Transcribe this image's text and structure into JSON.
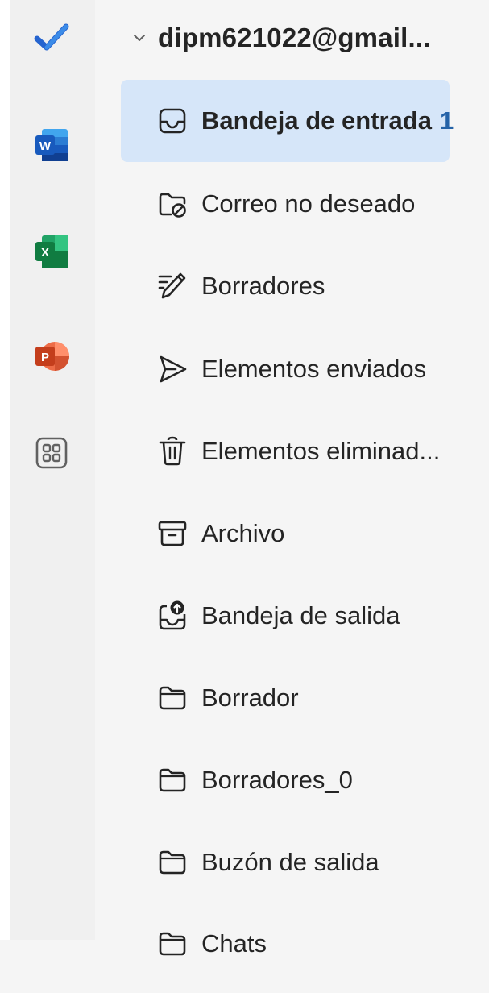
{
  "rail": {
    "apps": [
      {
        "name": "To Do",
        "icon": "todo-check-icon",
        "color": "#2564cf"
      },
      {
        "name": "Word",
        "icon": "word-icon",
        "color": "#185abd"
      },
      {
        "name": "Excel",
        "icon": "excel-icon",
        "color": "#107c41"
      },
      {
        "name": "PowerPoint",
        "icon": "powerpoint-icon",
        "color": "#c43e1c"
      },
      {
        "name": "More apps",
        "icon": "apps-grid-icon",
        "color": "#616161"
      }
    ]
  },
  "account": {
    "email": "dipm621022@gmail...",
    "expanded": true
  },
  "folders": [
    {
      "label": "Bandeja de entrada",
      "count": "1",
      "icon": "inbox-icon",
      "selected": true
    },
    {
      "label": "Correo no deseado",
      "icon": "junk-folder-icon"
    },
    {
      "label": "Borradores",
      "icon": "drafts-pencil-icon"
    },
    {
      "label": "Elementos enviados",
      "icon": "send-icon"
    },
    {
      "label": "Elementos eliminad...",
      "icon": "trash-icon"
    },
    {
      "label": "Archivo",
      "icon": "archive-icon"
    },
    {
      "label": "Bandeja de salida",
      "icon": "outbox-icon"
    },
    {
      "label": "Borrador",
      "icon": "folder-icon"
    },
    {
      "label": "Borradores_0",
      "icon": "folder-icon"
    },
    {
      "label": "Buzón de salida",
      "icon": "folder-icon"
    },
    {
      "label": "Chats",
      "icon": "folder-icon"
    }
  ],
  "colors": {
    "selected_bg": "#d6e6f9",
    "count": "#2563a8",
    "text": "#242424"
  }
}
